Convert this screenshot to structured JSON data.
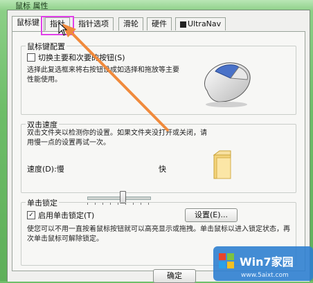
{
  "window": {
    "title": "鼠标 属性"
  },
  "tabs": [
    {
      "label": "鼠标键"
    },
    {
      "label": "指针"
    },
    {
      "label": "指针选项"
    },
    {
      "label": "滑轮"
    },
    {
      "label": "硬件"
    },
    {
      "label": "UltraNav"
    }
  ],
  "buttons_config": {
    "title": "鼠标键配置",
    "checkbox_label": "切换主要和次要的按钮(S)",
    "checked": false,
    "description": "选择此复选框来将右按钮设成如选择和拖放等主要性能使用。"
  },
  "double_click": {
    "title": "双击速度",
    "description": "双击文件夹以检测你的设置。如果文件夹没打开或关闭，请用慢一点的设置再试一次。",
    "speed_label": "速度(D):慢",
    "fast_label": "快",
    "speed_level": 0.55
  },
  "click_lock": {
    "title": "单击锁定",
    "checkbox_label": "启用单击锁定(T)",
    "checked": true,
    "settings_button": "设置(E)...",
    "description": "使您可以不用一直按着鼠标按钮就可以高亮显示或拖拽。单击鼠标以进入锁定状态，再次单击鼠标可解除锁定。"
  },
  "footer": {
    "ok_button": "确定"
  },
  "watermark": {
    "text": "Win7家园",
    "url": "www.5aixt.com"
  },
  "colors": {
    "highlight": "#e040e8",
    "arrow": "#f08a3c",
    "window_green": "#6fbf6a"
  }
}
